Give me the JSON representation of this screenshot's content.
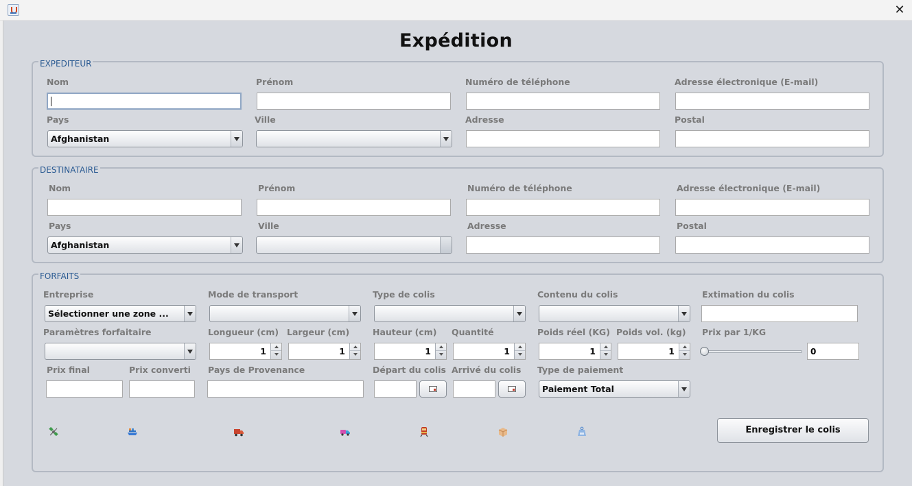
{
  "window": {
    "close_symbol": "✕"
  },
  "heading": "Expédition",
  "expediteur": {
    "legend": "EXPEDITEUR",
    "labels": {
      "nom": "Nom",
      "prenom": "Prénom",
      "tel": "Numéro de téléphone",
      "email": "Adresse électronique (E-mail)",
      "pays": "Pays",
      "ville": "Ville",
      "adresse": "Adresse",
      "postal": "Postal"
    },
    "values": {
      "nom": "",
      "prenom": "",
      "tel": "",
      "email": "",
      "adresse": "",
      "postal": ""
    },
    "pays_selected": "Afghanistan",
    "ville_selected": ""
  },
  "destinataire": {
    "legend": "DESTINATAIRE",
    "labels": {
      "nom": "Nom",
      "prenom": "Prénom",
      "tel": "Numéro de téléphone",
      "email": "Adresse électronique (E-mail)",
      "pays": "Pays",
      "ville": "Ville",
      "adresse": "Adresse",
      "postal": "Postal"
    },
    "values": {
      "nom": "",
      "prenom": "",
      "tel": "",
      "email": "",
      "adresse": "",
      "postal": ""
    },
    "pays_selected": "Afghanistan",
    "ville_selected": ""
  },
  "forfaits": {
    "legend": "FORFAITS",
    "labels": {
      "entreprise": "Entreprise",
      "mode": "Mode de transport",
      "type": "Type de colis",
      "contenu": "Contenu du colis",
      "estimation": "Extimation du colis",
      "parametres": "Paramètres forfaitaire",
      "longueur": "Longueur (cm)",
      "largeur": "Largeur (cm)",
      "hauteur": "Hauteur (cm)",
      "quantite": "Quantité",
      "poids_reel": "Poids réel (KG)",
      "poids_vol": "Poids vol. (kg)",
      "prix_kg": "Prix par 1/KG",
      "prix_final": "Prix final",
      "prix_converti": "Prix converti",
      "provenance": "Pays de Provenance",
      "depart": "Départ du colis",
      "arrive": "Arrivé du colis",
      "paiement": "Type de paiement"
    },
    "entreprise_selected": "Sélectionner une zone ...",
    "mode_selected": "",
    "type_selected": "",
    "contenu_selected": "",
    "parametres_selected": "",
    "estimation_value": "",
    "spinners": {
      "longueur": "1",
      "largeur": "1",
      "hauteur": "1",
      "quantite": "1",
      "poids_reel": "1",
      "poids_vol": "1"
    },
    "prix_kg_value": "0",
    "prix_kg_slider_fraction": 0,
    "values": {
      "prix_final": "",
      "prix_converti": "",
      "provenance": "",
      "depart": "",
      "arrive": ""
    },
    "paiement_selected": "Paiement Total",
    "transport_icons": [
      "satellite-icon",
      "ship-icon",
      "truck-icon",
      "delivery-van-icon",
      "train-icon",
      "package-box-icon",
      "weight-kg-icon"
    ],
    "save_button": "Enregistrer le colis"
  }
}
